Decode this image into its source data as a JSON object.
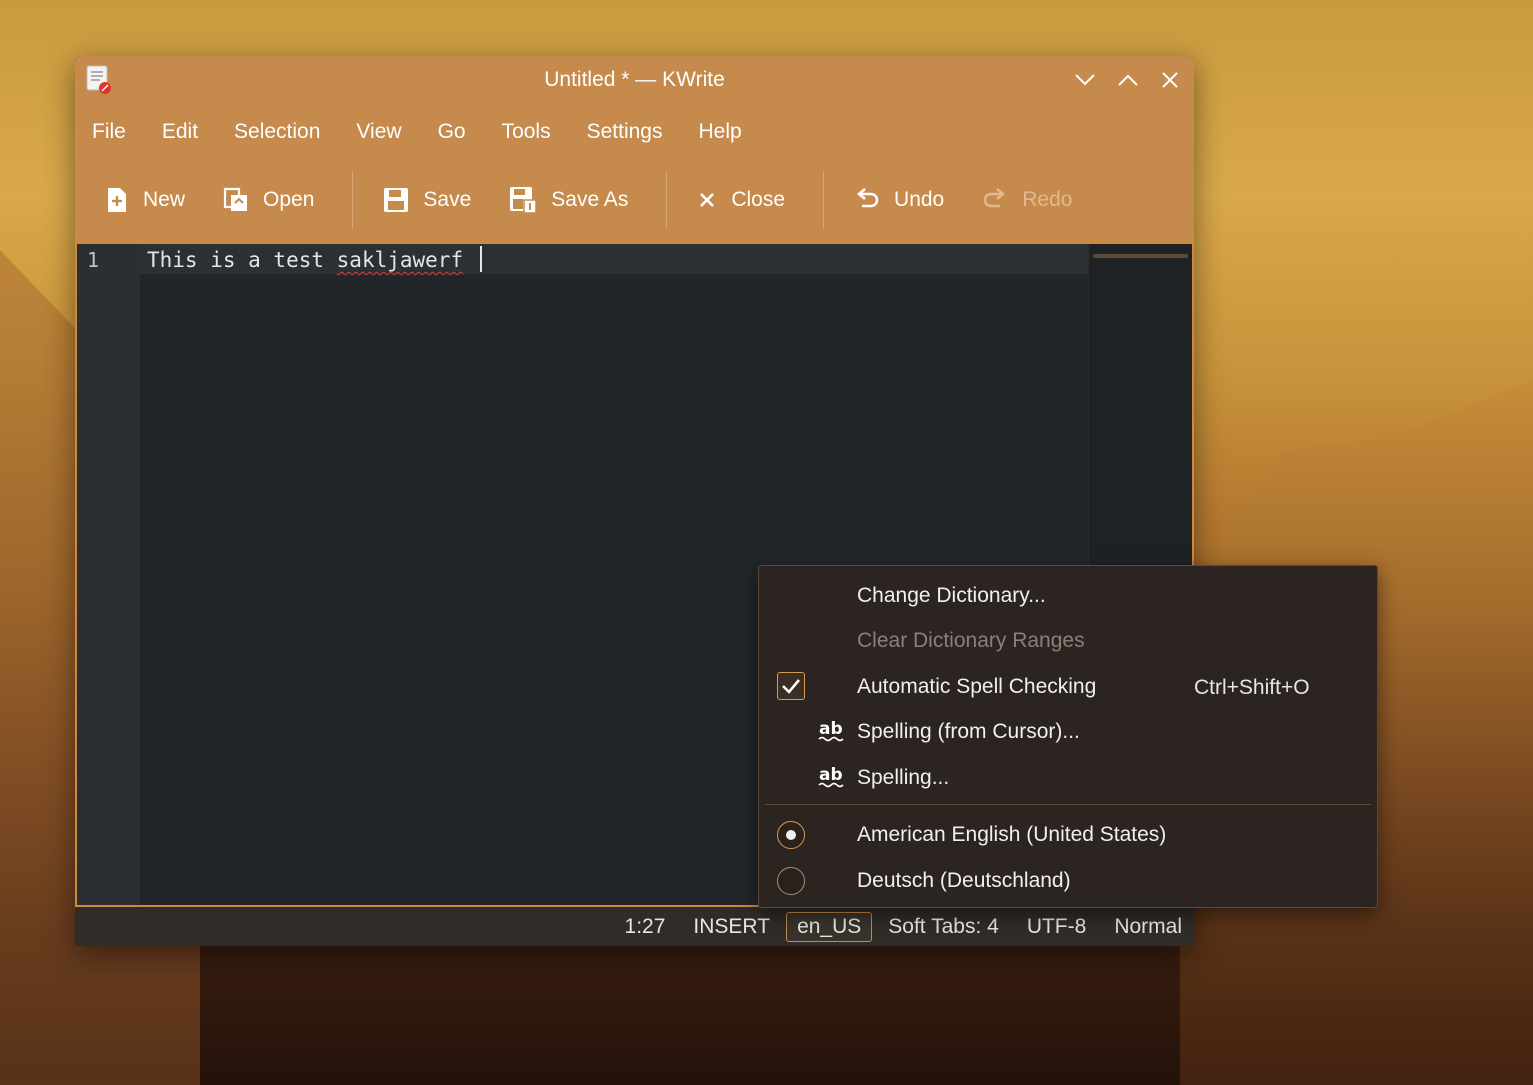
{
  "window": {
    "title": "Untitled * — KWrite",
    "app_icon": "kwrite-icon"
  },
  "menubar": [
    "File",
    "Edit",
    "Selection",
    "View",
    "Go",
    "Tools",
    "Settings",
    "Help"
  ],
  "toolbar": {
    "new": "New",
    "open": "Open",
    "save": "Save",
    "save_as": "Save As",
    "close": "Close",
    "undo": "Undo",
    "redo": "Redo"
  },
  "editor": {
    "line_number": "1",
    "text_before": "This is a test ",
    "misspelled": "sakljawerf",
    "text_after": " "
  },
  "statusbar": {
    "cursor": "1:27",
    "mode": "INSERT",
    "language": "en_US",
    "indent": "Soft Tabs: 4",
    "encoding": "UTF-8",
    "view_mode": "Normal"
  },
  "popup": {
    "change_dictionary": "Change Dictionary...",
    "clear_ranges": "Clear Dictionary Ranges",
    "auto_spell": "Automatic Spell Checking",
    "auto_spell_shortcut": "Ctrl+Shift+O",
    "spelling_cursor": "Spelling (from Cursor)...",
    "spelling": "Spelling...",
    "lang_en": "American English (United States)",
    "lang_de": "Deutsch (Deutschland)"
  },
  "colors": {
    "accent": "#c58a4c",
    "editor_bg": "#232629",
    "menu_bg": "#2c2420"
  }
}
